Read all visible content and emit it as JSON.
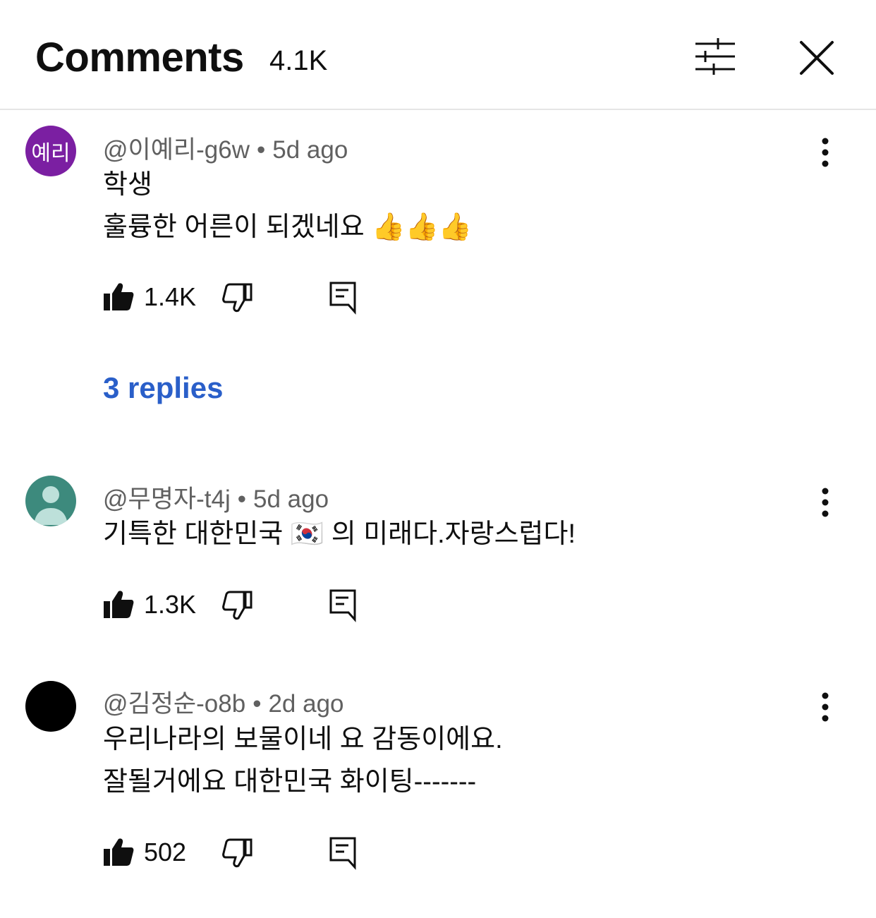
{
  "header": {
    "title": "Comments",
    "count": "4.1K"
  },
  "icons": {
    "filter": "sliders-icon",
    "close": "close-icon",
    "like": "thumbs-up-icon",
    "dislike": "thumbs-down-icon",
    "reply": "reply-icon",
    "more": "more-vertical-icon"
  },
  "comments": [
    {
      "avatar_text": "예리",
      "author": "@이예리-g6w",
      "time": "5d ago",
      "lines": [
        "학생",
        "훌륭한 어른이 되겠네요 👍👍👍"
      ],
      "likes": "1.4K",
      "replies_label": "3 replies"
    },
    {
      "author": "@무명자-t4j",
      "time": "5d ago",
      "lines": [
        "기특한 대한민국 🇰🇷 의 미래다.자랑스럽다!"
      ],
      "likes": "1.3K"
    },
    {
      "author": "@김정순-o8b",
      "time": "2d ago",
      "lines": [
        "우리나라의  보물이네 요 감동이에요.",
        "잘될거에요 대한민국 화이팅-------"
      ],
      "likes": "502"
    }
  ]
}
